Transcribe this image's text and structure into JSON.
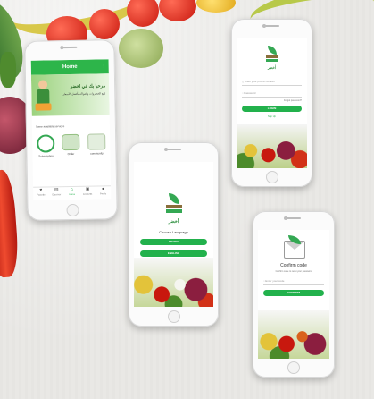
{
  "home": {
    "title": "Home",
    "welcome": "مرحبا بك في اخضر",
    "subtitle": "لبيع الخضروات والفواكه بأفضل الأسعار",
    "services_label": "Some available services",
    "services": [
      "Subscription",
      "Order",
      "community"
    ],
    "nav": [
      "Favorite",
      "Discover",
      "Home",
      "Accounts",
      "Profile"
    ]
  },
  "language": {
    "logo_text": "أخضر",
    "title": "Choose Language",
    "arabic": "ARABIC",
    "english": "ENGLISH"
  },
  "login": {
    "logo_text": "أخضر",
    "phone_placeholder": "Enter your phone number",
    "password_placeholder": "Password",
    "forgot": "Forgot password?",
    "login_button": "LOGIN",
    "signup": "Sign Up"
  },
  "confirm": {
    "title": "Confirm code",
    "subtitle": "Confirm code to reset your password",
    "code_placeholder": "Enter your code",
    "confirm_button": "CONFIRM"
  },
  "colors": {
    "brand_green": "#22b14c",
    "background": "#e9e8e5"
  }
}
